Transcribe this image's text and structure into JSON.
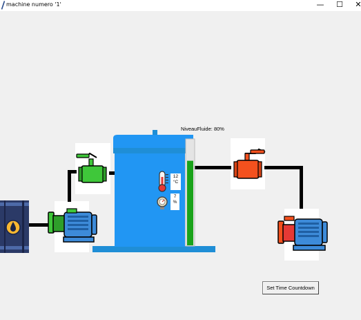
{
  "window": {
    "title": "machine numero '1'",
    "minimize_glyph": "—",
    "maximize_glyph": "☐",
    "close_glyph": "✕"
  },
  "tank": {
    "level_label": "NiveauFluide: 80%",
    "level_fraction": 0.8,
    "temperature": {
      "value": "12",
      "unit": "°C",
      "icon": "thermometer-icon"
    },
    "pressure": {
      "value": "7",
      "unit": "%",
      "icon": "pressure-gauge-icon"
    }
  },
  "controls": {
    "countdown_label": "Set Time Countdown"
  },
  "icons": {
    "barrel": "oil-barrel-icon",
    "inlet_pump": "green-pump-icon",
    "inlet_valve": "green-valve-icon",
    "outlet_valve": "orange-valve-icon",
    "outlet_pump": "red-pump-icon"
  },
  "colors": {
    "tank": "#2196f3",
    "level_fill": "#1aa31a",
    "inlet": "#3fc73a",
    "outlet": "#f4511e",
    "pipe": "#000000",
    "motor": "#3d8bd9",
    "barrel": "#2b3a67"
  }
}
